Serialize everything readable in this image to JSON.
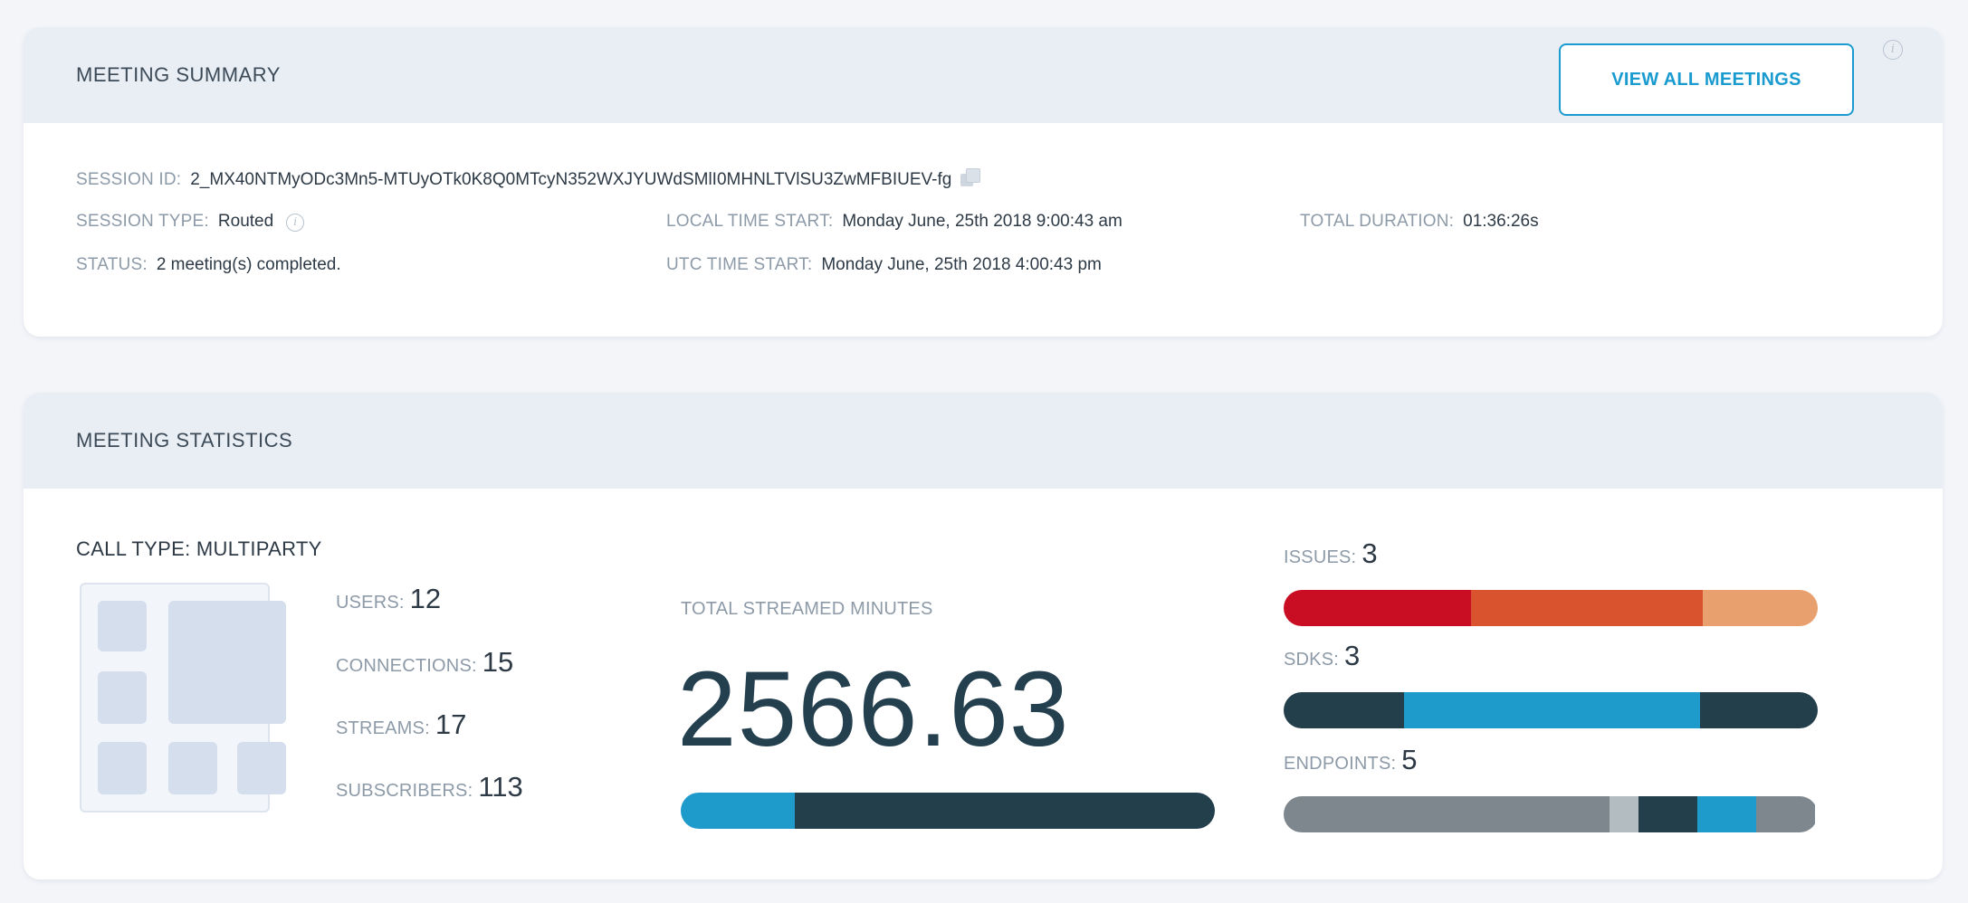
{
  "summary": {
    "title": "MEETING SUMMARY",
    "view_all_label": "VIEW ALL MEETINGS",
    "session_id_label": "SESSION ID:",
    "session_id_value": "2_MX40NTMyODc3Mn5-MTUyOTk0K8Q0MTcyN352WXJYUWdSMlI0MHNLTVlSU3ZwMFBIUEV-fg",
    "session_type_label": "SESSION TYPE:",
    "session_type_value": "Routed",
    "status_label": "STATUS:",
    "status_value": "2 meeting(s) completed.",
    "local_time_label": "LOCAL TIME START:",
    "local_time_value": "Monday June, 25th 2018 9:00:43 am",
    "utc_time_label": "UTC TIME START:",
    "utc_time_value": "Monday June, 25th 2018 4:00:43 pm",
    "duration_label": "TOTAL DURATION:",
    "duration_value": "01:36:26s"
  },
  "stats": {
    "title": "MEETING STATISTICS",
    "call_type": "CALL TYPE: MULTIPARTY",
    "users_label": "USERS:",
    "users_value": "12",
    "connections_label": "CONNECTIONS:",
    "connections_value": "15",
    "streams_label": "STREAMS:",
    "streams_value": "17",
    "subscribers_label": "SUBSCRIBERS:",
    "subscribers_value": "113",
    "total_streamed_label": "TOTAL STREAMED MINUTES",
    "total_streamed_value": "2566.63",
    "issues_label": "ISSUES:",
    "issues_value": "3",
    "sdks_label": "SDKS:",
    "sdks_value": "3",
    "endpoints_label": "ENDPOINTS:",
    "endpoints_value": "5"
  },
  "bars": {
    "streamed_minutes": [
      {
        "fraction": 0.213,
        "color": "#1e9acb"
      },
      {
        "fraction": 0.787,
        "color": "#233f4c"
      }
    ],
    "issues": [
      {
        "fraction": 0.35,
        "color": "#c90e24"
      },
      {
        "fraction": 0.435,
        "color": "#d9532f"
      },
      {
        "fraction": 0.215,
        "color": "#e8a06e"
      }
    ],
    "sdks": [
      {
        "fraction": 0.225,
        "color": "#233f4c"
      },
      {
        "fraction": 0.555,
        "color": "#1e9acb"
      },
      {
        "fraction": 0.22,
        "color": "#233f4c"
      }
    ],
    "endpoints": [
      {
        "fraction": 0.61,
        "color": "#7d878d"
      },
      {
        "fraction": 0.055,
        "color": "#b2bcc1"
      },
      {
        "fraction": 0.11,
        "color": "#233f4c"
      },
      {
        "fraction": 0.11,
        "color": "#1e9acb"
      },
      {
        "fraction": 0.11,
        "color": "#7d878d"
      }
    ]
  },
  "icons": {
    "info": "info-icon",
    "copy": "copy-icon"
  }
}
